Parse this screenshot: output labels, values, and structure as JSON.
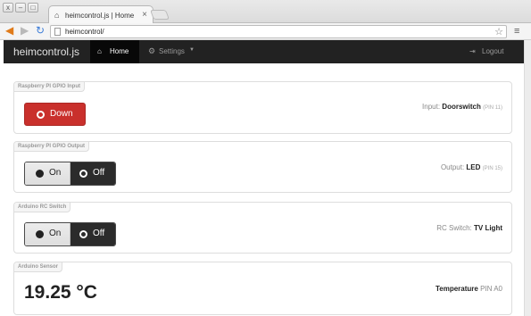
{
  "browser": {
    "window_buttons": [
      "x",
      "–",
      "□"
    ],
    "tab_title": "heimcontrol.js | Home",
    "tab_close": "×",
    "url": "heimcontrol/"
  },
  "navbar": {
    "brand": "heimcontrol.js",
    "home": "Home",
    "settings": "Settings",
    "logout": "Logout"
  },
  "cards": {
    "gpio_input": {
      "label": "Raspberry PI GPIO Input",
      "button": "Down",
      "info_prefix": "Input:",
      "info_name": "Doorswitch",
      "info_pin": "(PIN 11)"
    },
    "gpio_output": {
      "label": "Raspberry PI GPIO Output",
      "on": "On",
      "off": "Off",
      "info_prefix": "Output:",
      "info_name": "LED",
      "info_pin": "(PIN 15)"
    },
    "rc_switch": {
      "label": "Arduino RC Switch",
      "on": "On",
      "off": "Off",
      "info_prefix": "RC Switch:",
      "info_name": "TV Light"
    },
    "sensor": {
      "label": "Arduino Sensor",
      "value": "19.25 °C",
      "info_name": "Temperature",
      "info_pin": "PIN A0"
    }
  },
  "colors": {
    "navbar": "#222222",
    "danger": "#c9302c",
    "toggle_active": "#2b2b2b"
  },
  "icons": [
    "home-icon",
    "gear-icon",
    "logout-icon",
    "star-icon",
    "menu-icon",
    "back-arrow-icon",
    "forward-arrow-icon",
    "reload-icon",
    "page-icon"
  ]
}
